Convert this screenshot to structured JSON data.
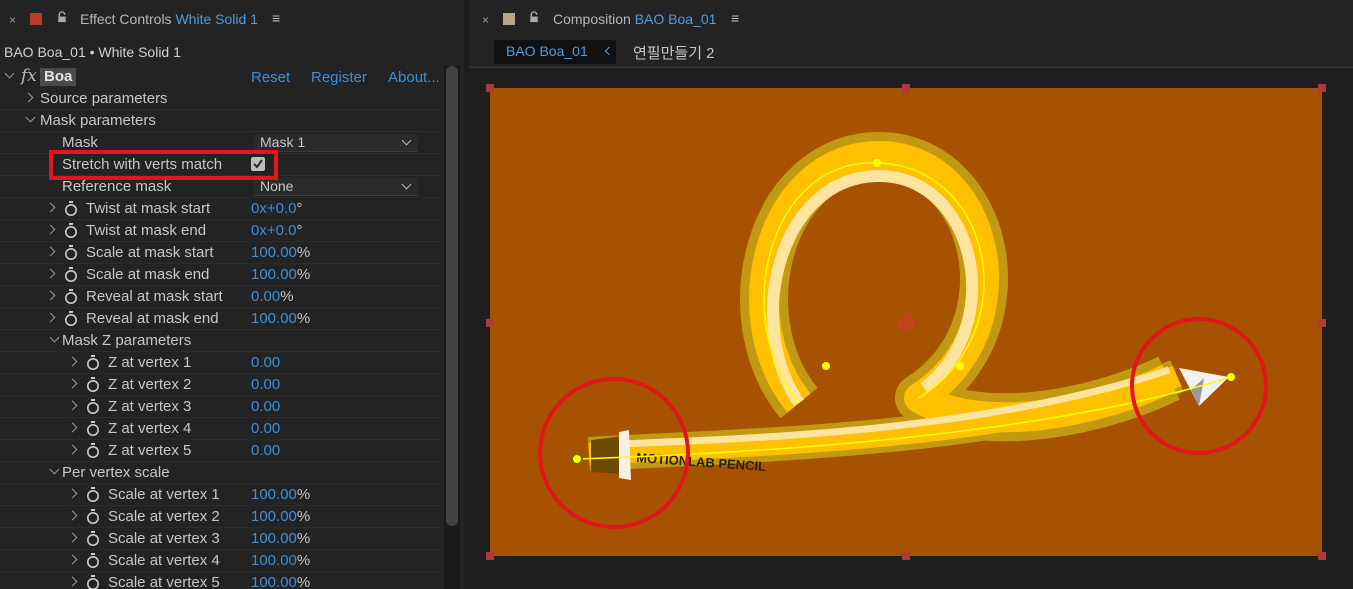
{
  "effect_controls": {
    "close": "×",
    "tab_label": "Effect Controls",
    "tab_layer": "White Solid 1",
    "menu": "≡",
    "swatch_color": "#c0392b",
    "subtitle": "BAO Boa_01 • White Solid 1",
    "fx_symbol": "fx",
    "effect_name": "Boa",
    "reset": "Reset",
    "register": "Register",
    "about": "About...",
    "groups": {
      "source": "Source parameters",
      "mask": "Mask parameters",
      "mask_z": "Mask Z parameters",
      "per_vertex": "Per vertex scale"
    },
    "mask": {
      "label": "Mask",
      "value": "Mask 1"
    },
    "stretch": {
      "label": "Stretch with verts match",
      "checked": true
    },
    "reference": {
      "label": "Reference mask",
      "value": "None"
    },
    "twist_start": {
      "label": "Twist at mask start",
      "value": "0x+0.0",
      "unit": "°"
    },
    "twist_end": {
      "label": "Twist at mask end",
      "value": "0x+0.0",
      "unit": "°"
    },
    "scale_start": {
      "label": "Scale at mask start",
      "value": "100.00",
      "unit": "%"
    },
    "scale_end": {
      "label": "Scale at mask end",
      "value": "100.00",
      "unit": "%"
    },
    "reveal_start": {
      "label": "Reveal at mask start",
      "value": "0.00",
      "unit": "%"
    },
    "reveal_end": {
      "label": "Reveal at mask end",
      "value": "100.00",
      "unit": "%"
    },
    "z_vertices": [
      {
        "label": "Z at vertex 1",
        "value": "0.00"
      },
      {
        "label": "Z at vertex 2",
        "value": "0.00"
      },
      {
        "label": "Z at vertex 3",
        "value": "0.00"
      },
      {
        "label": "Z at vertex 4",
        "value": "0.00"
      },
      {
        "label": "Z at vertex 5",
        "value": "0.00"
      }
    ],
    "scale_vertices": [
      {
        "label": "Scale at vertex 1",
        "value": "100.00",
        "unit": "%"
      },
      {
        "label": "Scale at vertex 2",
        "value": "100.00",
        "unit": "%"
      },
      {
        "label": "Scale at vertex 3",
        "value": "100.00",
        "unit": "%"
      },
      {
        "label": "Scale at vertex 4",
        "value": "100.00",
        "unit": "%"
      },
      {
        "label": "Scale at vertex 5",
        "value": "100.00",
        "unit": "%"
      }
    ],
    "highlight_color": "#e0161c"
  },
  "composition": {
    "close": "×",
    "tab_label": "Composition",
    "tab_comp": "BAO Boa_01",
    "menu": "≡",
    "swatch_color": "#b8a58a",
    "crumb_active": "BAO Boa_01",
    "crumb_next": "연필만들기 2",
    "canvas_color": "#a65200",
    "pencil_text": "MOTIONLAB PENCIL",
    "annotation_color": "#e0161c"
  },
  "colors": {
    "accent": "#3e8ed8",
    "tube_outer": "#c29a12",
    "tube_main": "#ffc000",
    "tube_highlight": "#ffe4a0",
    "path": "#ffff00"
  }
}
